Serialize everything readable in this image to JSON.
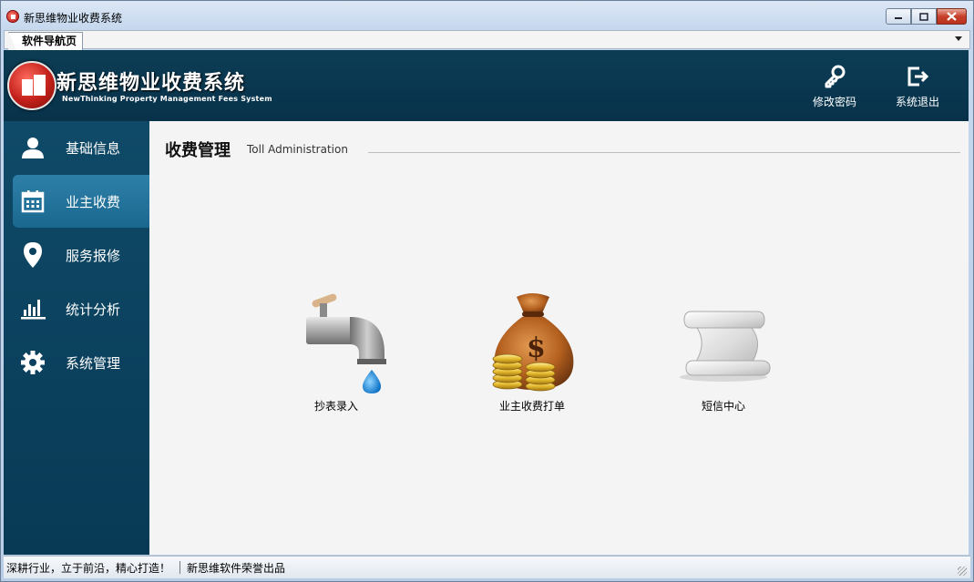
{
  "window": {
    "title": "新思维物业收费系统"
  },
  "tabs": [
    {
      "label": "软件导航页"
    }
  ],
  "header": {
    "title": "新思维物业收费系统",
    "subtitle": "NewThinking  Property Management Fees System",
    "actions": [
      {
        "label": "修改密码",
        "icon": "key-icon"
      },
      {
        "label": "系统退出",
        "icon": "logout-icon"
      }
    ]
  },
  "sidebar": {
    "items": [
      {
        "label": "基础信息",
        "icon": "user-icon",
        "active": false
      },
      {
        "label": "业主收费",
        "icon": "calendar-icon",
        "active": true
      },
      {
        "label": "服务报修",
        "icon": "location-pin-icon",
        "active": false
      },
      {
        "label": "统计分析",
        "icon": "bar-chart-icon",
        "active": false
      },
      {
        "label": "系统管理",
        "icon": "gear-icon",
        "active": false
      }
    ]
  },
  "main": {
    "title": "收费管理",
    "subtitle": "Toll Administration",
    "tiles": [
      {
        "label": "抄表录入",
        "icon": "faucet-icon"
      },
      {
        "label": "业主收费打单",
        "icon": "money-bag-icon"
      },
      {
        "label": "短信中心",
        "icon": "scroll-icon"
      }
    ]
  },
  "statusbar": {
    "left": "深耕行业，立于前沿，精心打造！",
    "right": "新思维软件荣誉出品"
  },
  "colors": {
    "header_bg": "#0a3850",
    "sidebar_bg": "#0c4260",
    "active_item": "#2676a0"
  }
}
